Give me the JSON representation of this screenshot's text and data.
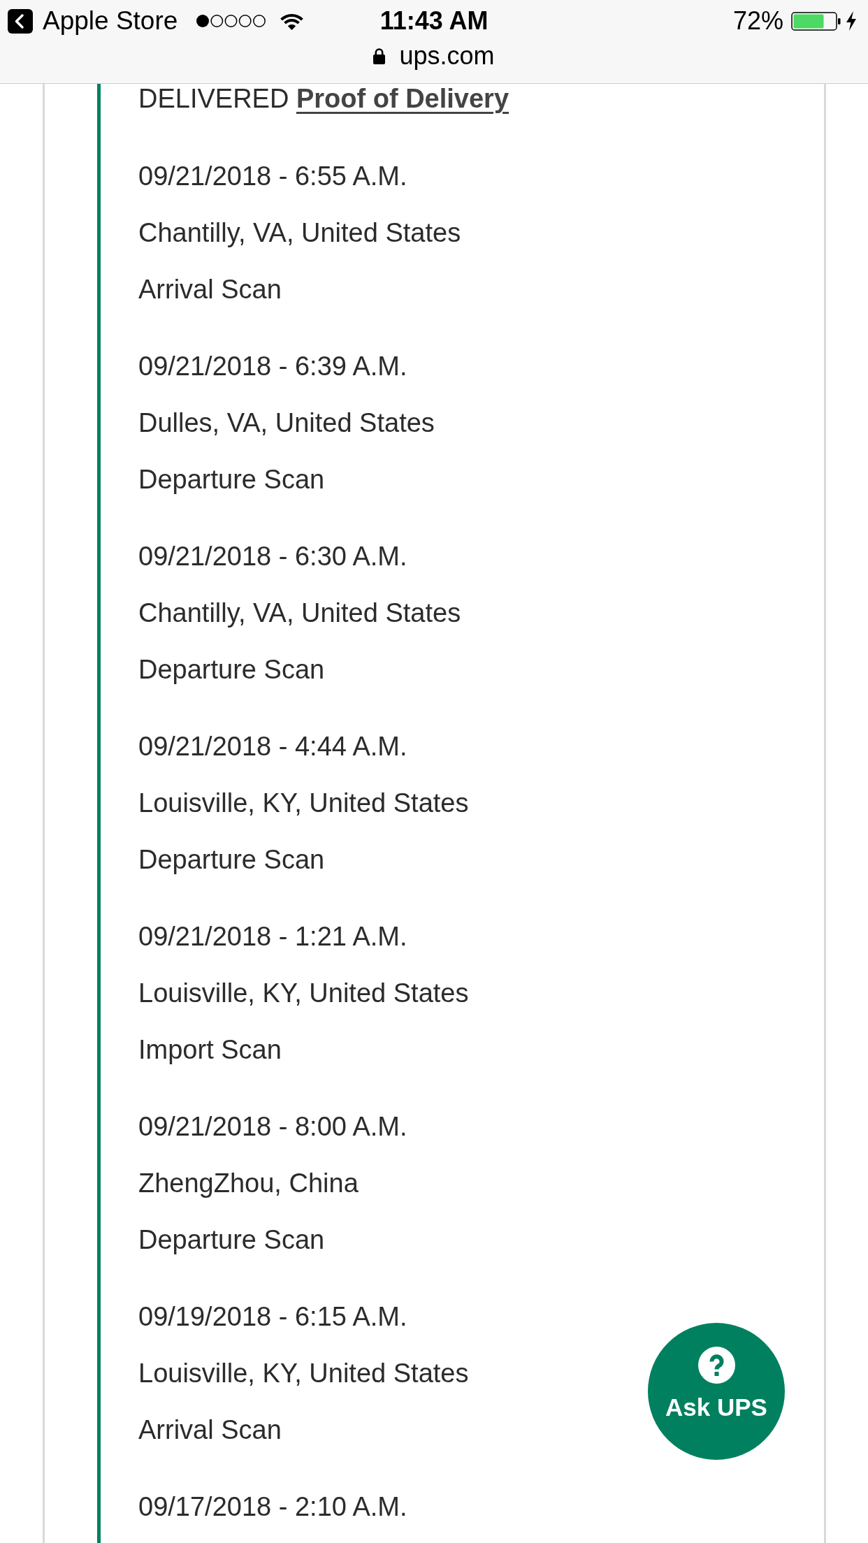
{
  "status_bar": {
    "back_label": "Apple Store",
    "time": "11:43 AM",
    "battery": "72%",
    "url": "ups.com"
  },
  "tracking": {
    "status": "DELIVERED",
    "proof_link": "Proof of Delivery",
    "events": [
      {
        "date": "09/21/2018 - 6:55 A.M.",
        "location": "Chantilly, VA, United States",
        "activity": "Arrival Scan"
      },
      {
        "date": "09/21/2018 - 6:39 A.M.",
        "location": "Dulles, VA, United States",
        "activity": "Departure Scan"
      },
      {
        "date": "09/21/2018 - 6:30 A.M.",
        "location": "Chantilly, VA, United States",
        "activity": "Departure Scan"
      },
      {
        "date": "09/21/2018 - 4:44 A.M.",
        "location": "Louisville, KY, United States",
        "activity": "Departure Scan"
      },
      {
        "date": "09/21/2018 - 1:21 A.M.",
        "location": "Louisville, KY, United States",
        "activity": "Import Scan"
      },
      {
        "date": "09/21/2018 - 8:00 A.M.",
        "location": "ZhengZhou, China",
        "activity": "Departure Scan"
      },
      {
        "date": "09/19/2018 - 6:15 A.M.",
        "location": "Louisville, KY, United States",
        "activity": "Arrival Scan"
      },
      {
        "date": "09/17/2018 - 2:10 A.M."
      }
    ]
  },
  "ask_button": {
    "label": "Ask UPS"
  }
}
